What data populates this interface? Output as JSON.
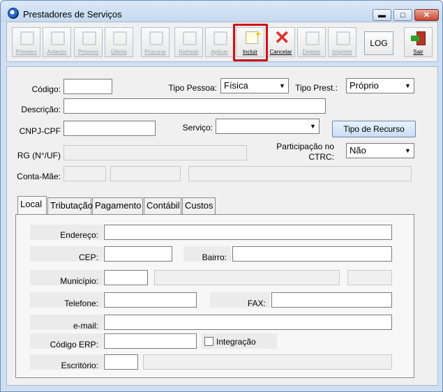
{
  "window": {
    "title": "Prestadores de Serviços",
    "minimize": "▬",
    "maximize": "□",
    "close": "✕"
  },
  "toolbar": {
    "buttons": [
      {
        "label": "Primeiro",
        "state": "disabled"
      },
      {
        "label": "Anterior",
        "state": "disabled"
      },
      {
        "label": "Próximo",
        "state": "disabled"
      },
      {
        "label": "Último",
        "state": "disabled"
      },
      {
        "label": "Procurar",
        "state": "disabled"
      },
      {
        "label": "Refresh",
        "state": "disabled"
      },
      {
        "label": "Aplicar",
        "state": "disabled"
      },
      {
        "label": "Incluir",
        "state": "active"
      },
      {
        "label": "Cancelar",
        "state": "active"
      },
      {
        "label": "Deletar",
        "state": "disabled"
      },
      {
        "label": "Imprimir",
        "state": "disabled"
      },
      {
        "label": "LOG",
        "state": "active"
      },
      {
        "label": "Sair",
        "state": "active"
      }
    ]
  },
  "form": {
    "codigo": {
      "label": "Código:",
      "value": ""
    },
    "tipo_pessoa": {
      "label": "Tipo Pessoa:",
      "value": "Física"
    },
    "tipo_prest": {
      "label": "Tipo Prest.:",
      "value": "Próprio"
    },
    "descricao": {
      "label": "Descrição:",
      "value": ""
    },
    "cnpj_cpf": {
      "label": "CNPJ-CPF",
      "value": ""
    },
    "servico": {
      "label": "Serviço:",
      "value": ""
    },
    "tipo_recurso_button": "Tipo de Recurso",
    "rg": {
      "label": "RG (N°/UF)",
      "value": ""
    },
    "participacao": {
      "label_line1": "Participação no",
      "label_line2": "CTRC:",
      "value": "Não"
    },
    "conta_mae": {
      "label": "Conta-Mãe:"
    }
  },
  "tabs": [
    "Local",
    "Tributação",
    "Pagamento",
    "Contábil",
    "Custos"
  ],
  "local": {
    "endereco": "Endereço:",
    "cep": "CEP:",
    "bairro": "Bairro:",
    "municipio": "Município:",
    "telefone": "Telefone:",
    "fax": "FAX:",
    "email": "e-mail:",
    "codigo_erp": "Código ERP:",
    "integracao": "Integração",
    "escritorio": "Escritório:"
  }
}
